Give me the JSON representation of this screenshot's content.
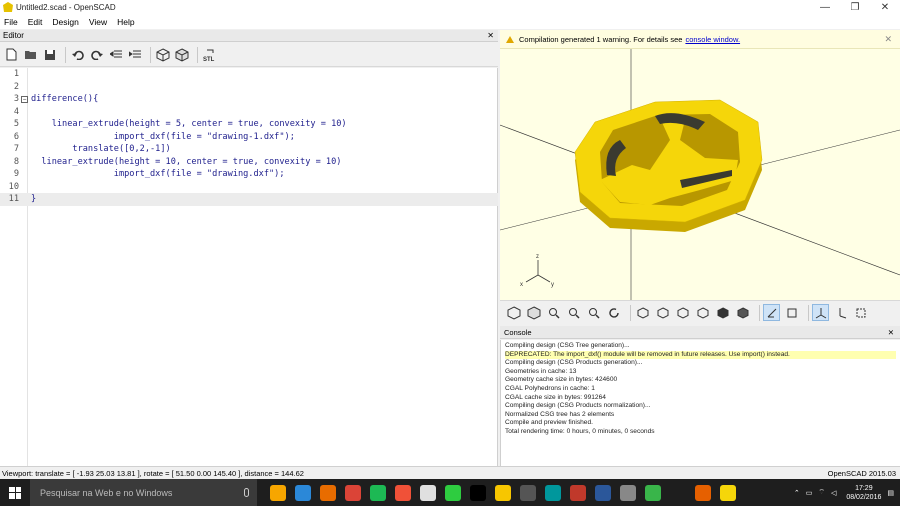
{
  "window": {
    "title": "Untitled2.scad - OpenSCAD",
    "min": "—",
    "max": "❐",
    "close": "✕"
  },
  "menu": [
    "File",
    "Edit",
    "Design",
    "View",
    "Help"
  ],
  "editor": {
    "header": "Editor",
    "close": "✕",
    "lines": [
      {
        "num": "1",
        "code": ""
      },
      {
        "num": "2",
        "code": ""
      },
      {
        "num": "3",
        "code": "difference(){"
      },
      {
        "num": "4",
        "code": ""
      },
      {
        "num": "5",
        "code": "    linear_extrude(height = 5, center = true, convexity = 10)"
      },
      {
        "num": "6",
        "code": "                import_dxf(file = \"drawing-1.dxf\");"
      },
      {
        "num": "7",
        "code": "        translate([0,2,-1])"
      },
      {
        "num": "8",
        "code": "  linear_extrude(height = 10, center = true, convexity = 10)"
      },
      {
        "num": "9",
        "code": "                import_dxf(file = \"drawing.dxf\");"
      },
      {
        "num": "10",
        "code": ""
      },
      {
        "num": "11",
        "code": "}"
      }
    ]
  },
  "viewer": {
    "warning_text": "Compilation generated 1 warning. For details see",
    "warning_link": "console window.",
    "close": "✕",
    "model_color": "#f5d60a",
    "background": "#ffffe5"
  },
  "console": {
    "header": "Console",
    "close": "✕",
    "messages": [
      "Compiling design (CSG Tree generation)...",
      "DEPRECATED: The import_dxf() module will be removed in future releases. Use import() instead.",
      "Compiling design (CSG Products generation)...",
      "Geometries in cache: 13",
      "Geometry cache size in bytes: 424600",
      "CGAL Polyhedrons in cache: 1",
      "CGAL cache size in bytes: 991264",
      "Compiling design (CSG Products normalization)...",
      "Normalized CSG tree has 2 elements",
      "Compile and preview finished.",
      "Total rendering time: 0 hours, 0 minutes, 0 seconds"
    ]
  },
  "status": {
    "left": "Viewport: translate = [ -1.93 25.03 13.81 ], rotate = [ 51.50 0.00 145.40 ], distance = 144.62",
    "right": "OpenSCAD 2015.03"
  },
  "taskbar": {
    "search_placeholder": "Pesquisar na Web e no Windows",
    "time": "17:29",
    "date": "08/02/2016",
    "app_colors": [
      "#f7a600",
      "#2b88d8",
      "#e86c00",
      "#db4437",
      "#1db954",
      "#f05138",
      "#e0e0e0",
      "#2ecc40",
      "#000000",
      "#f7c600",
      "#555555",
      "#00979c",
      "#c0392b",
      "#2b579a",
      "#888888",
      "#39b54a",
      "#1e1e1e",
      "#e66000",
      "#f5d60a"
    ]
  }
}
